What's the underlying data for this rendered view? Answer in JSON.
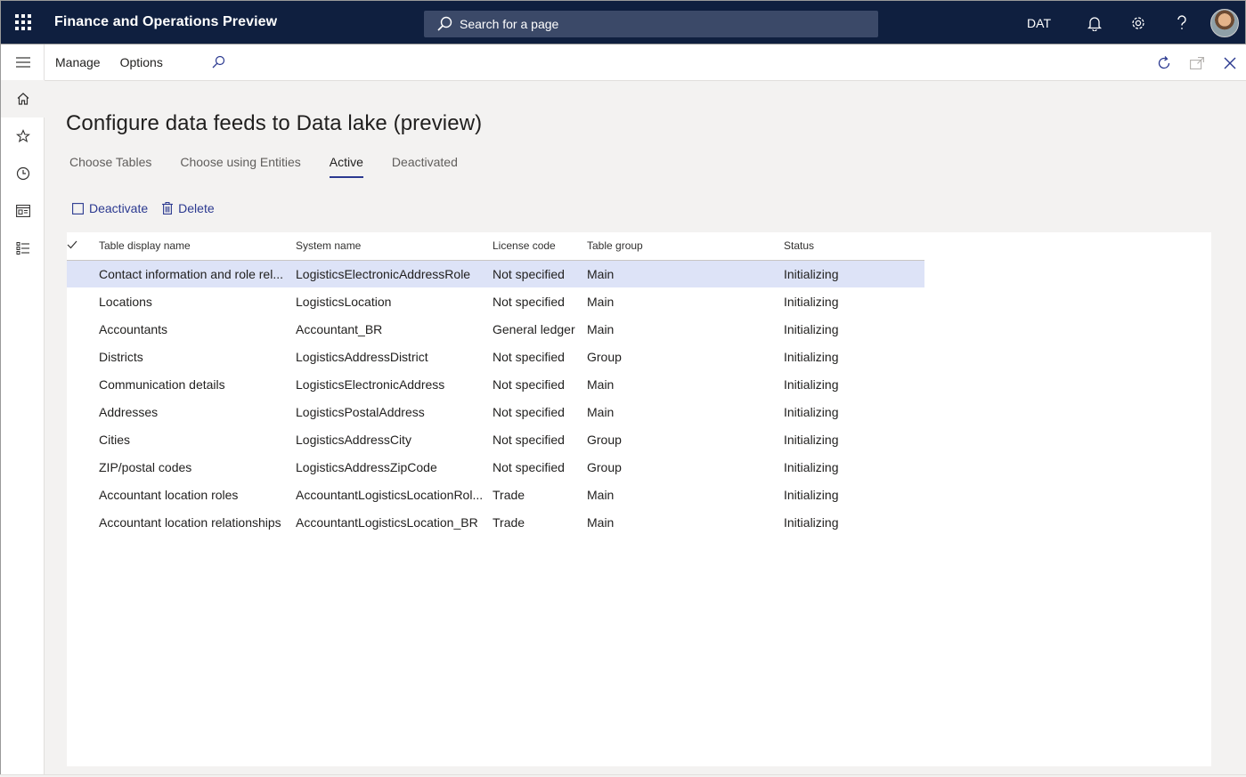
{
  "header": {
    "app_title": "Finance and Operations Preview",
    "search_placeholder": "Search for a page",
    "company": "DAT",
    "icons": [
      "waffle-icon",
      "search-icon",
      "bell-icon",
      "gear-icon",
      "help-icon",
      "user-avatar"
    ]
  },
  "actionbar": {
    "manage_label": "Manage",
    "options_label": "Options"
  },
  "page": {
    "title": "Configure data feeds to Data lake (preview)"
  },
  "tabs": [
    {
      "label": "Choose Tables",
      "active": false
    },
    {
      "label": "Choose using Entities",
      "active": false
    },
    {
      "label": "Active",
      "active": true
    },
    {
      "label": "Deactivated",
      "active": false
    }
  ],
  "grid_actions": {
    "deactivate_label": "Deactivate",
    "delete_label": "Delete"
  },
  "grid": {
    "columns": [
      "Table display name",
      "System name",
      "License code",
      "Table group",
      "Status"
    ],
    "rows": [
      {
        "name": "Contact information and role rel...",
        "system": "LogisticsElectronicAddressRole",
        "license": "Not specified",
        "group": "Main",
        "status": "Initializing",
        "selected": true
      },
      {
        "name": "Locations",
        "system": "LogisticsLocation",
        "license": "Not specified",
        "group": "Main",
        "status": "Initializing"
      },
      {
        "name": "Accountants",
        "system": "Accountant_BR",
        "license": "General ledger",
        "group": "Main",
        "status": "Initializing"
      },
      {
        "name": "Districts",
        "system": "LogisticsAddressDistrict",
        "license": "Not specified",
        "group": "Group",
        "status": "Initializing"
      },
      {
        "name": "Communication details",
        "system": "LogisticsElectronicAddress",
        "license": "Not specified",
        "group": "Main",
        "status": "Initializing"
      },
      {
        "name": "Addresses",
        "system": "LogisticsPostalAddress",
        "license": "Not specified",
        "group": "Main",
        "status": "Initializing"
      },
      {
        "name": "Cities",
        "system": "LogisticsAddressCity",
        "license": "Not specified",
        "group": "Group",
        "status": "Initializing"
      },
      {
        "name": "ZIP/postal codes",
        "system": "LogisticsAddressZipCode",
        "license": "Not specified",
        "group": "Group",
        "status": "Initializing"
      },
      {
        "name": "Accountant location roles",
        "system": "AccountantLogisticsLocationRol...",
        "license": "Trade",
        "group": "Main",
        "status": "Initializing"
      },
      {
        "name": "Accountant location relationships",
        "system": "AccountantLogisticsLocation_BR",
        "license": "Trade",
        "group": "Main",
        "status": "Initializing"
      }
    ]
  },
  "colors": {
    "topbar": "#0f1f3f",
    "accent": "#2b3990",
    "selected_row": "#dde3f7"
  }
}
